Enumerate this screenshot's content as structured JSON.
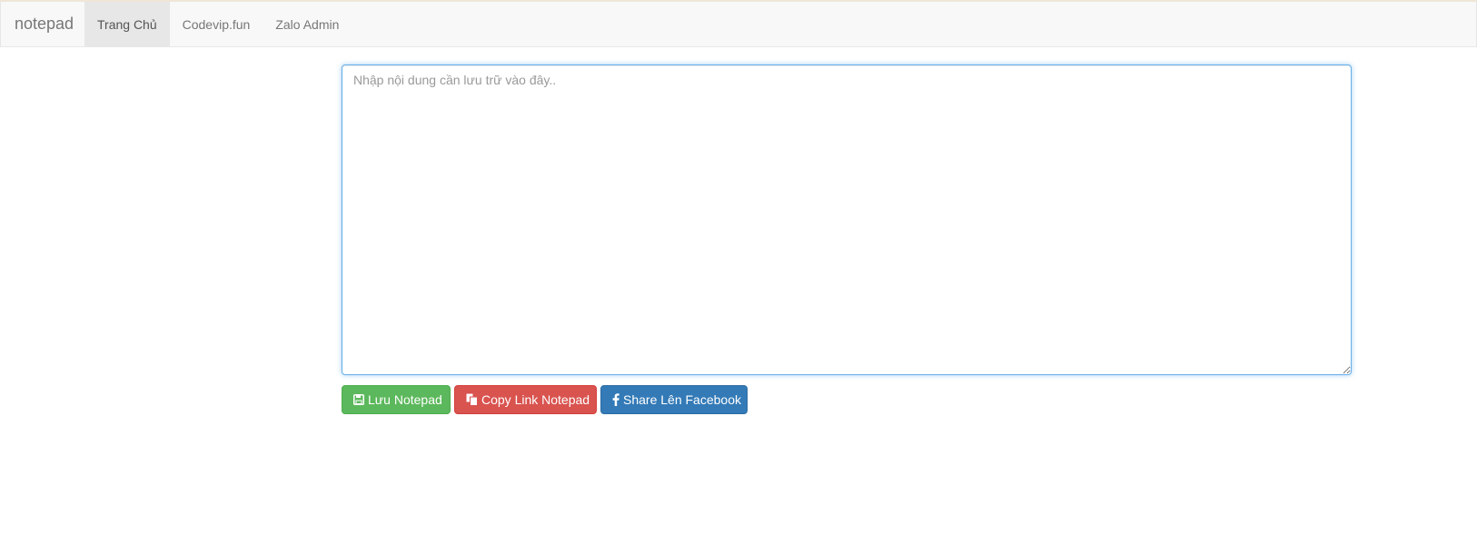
{
  "navbar": {
    "brand": "notepad",
    "items": [
      {
        "label": "Trang Chủ",
        "active": true
      },
      {
        "label": "Codevip.fun",
        "active": false
      },
      {
        "label": "Zalo Admin",
        "active": false
      }
    ]
  },
  "editor": {
    "placeholder": "Nhập nội dung cần lưu trữ vào đây..",
    "value": ""
  },
  "actions": {
    "save_label": "Lưu Notepad",
    "save_icon": "floppy-disk-icon",
    "copy_label": "Copy Link Notepad",
    "copy_icon": "copy-icon",
    "share_label": "Share Lên Facebook",
    "share_icon": "facebook-icon"
  },
  "colors": {
    "save": "#5cb85c",
    "copy": "#d9534f",
    "share": "#337ab7",
    "focus_border": "#66afe9"
  }
}
